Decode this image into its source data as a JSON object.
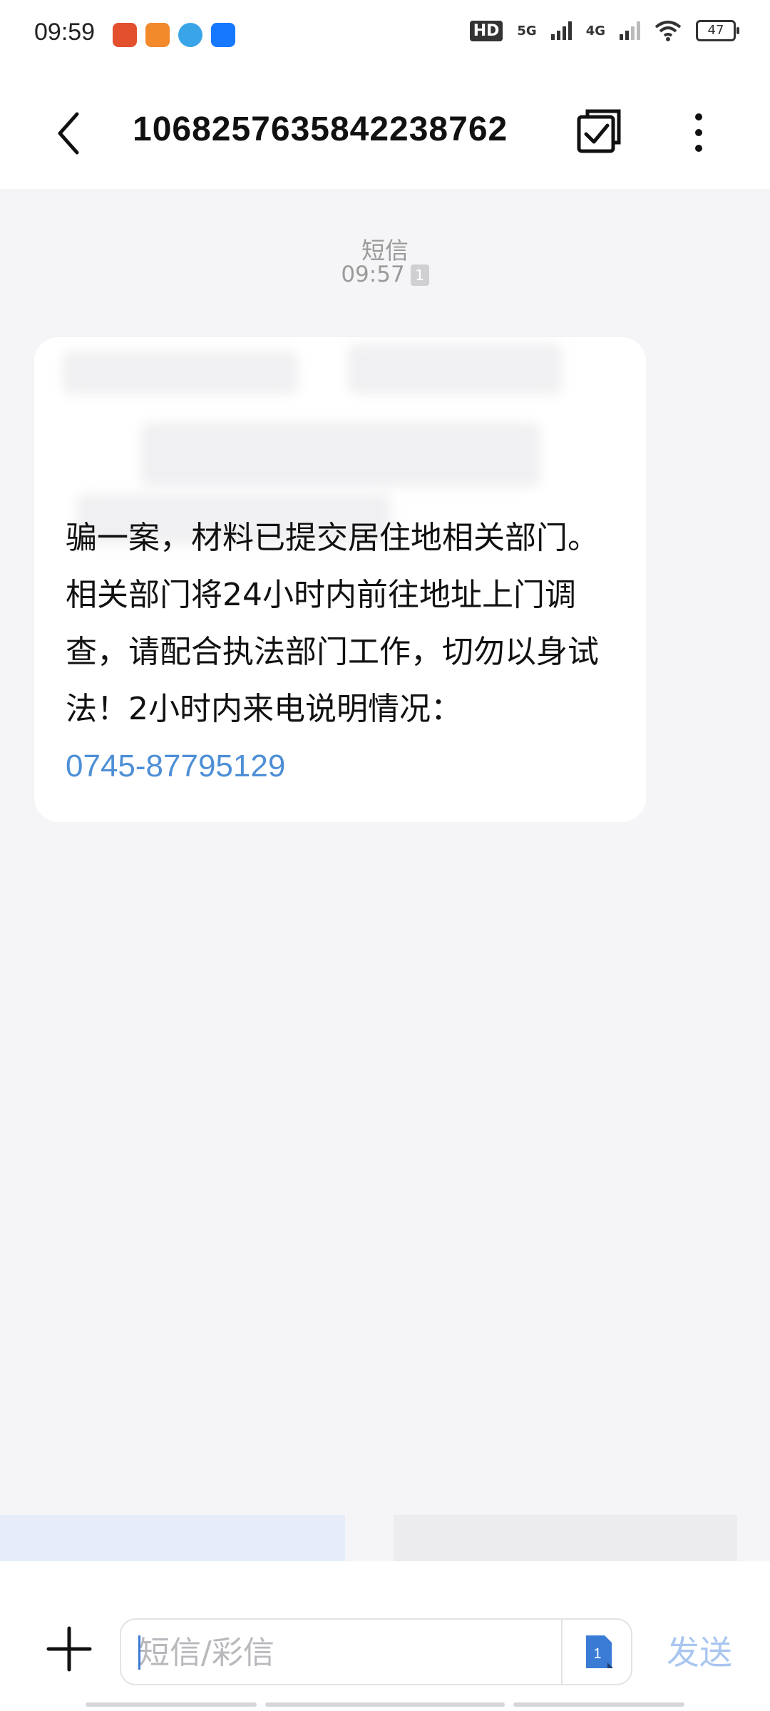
{
  "status_bar": {
    "time": "09:59",
    "network_1": "5G",
    "network_2": "4G",
    "hd_label": "HD",
    "battery": "47"
  },
  "header": {
    "title": "1068257635842238762",
    "back_icon": "chevron-left-icon",
    "select_icon": "multi-select-icon",
    "more_icon": "more-vertical-icon"
  },
  "conversation": {
    "channel_label": "短信",
    "time": "09:57",
    "sim_badge": "1",
    "message": {
      "visible_text": "骗一案，材料已提交居住地相关部门。相关部门将24小时内前往地址上门调查，请配合执法部门工作，切勿以身试法！2小时内来电说明情况：",
      "phone_link": "0745-87795129",
      "redacted": true
    }
  },
  "input_bar": {
    "placeholder": "短信/彩信",
    "value": "",
    "sim_label": "1",
    "send_label": "发送",
    "plus_icon": "plus-icon",
    "sim_icon": "sim-card-icon"
  },
  "colors": {
    "link": "#4e8fd6",
    "send_disabled": "#a9c6f0",
    "background": "#f5f5f7"
  }
}
